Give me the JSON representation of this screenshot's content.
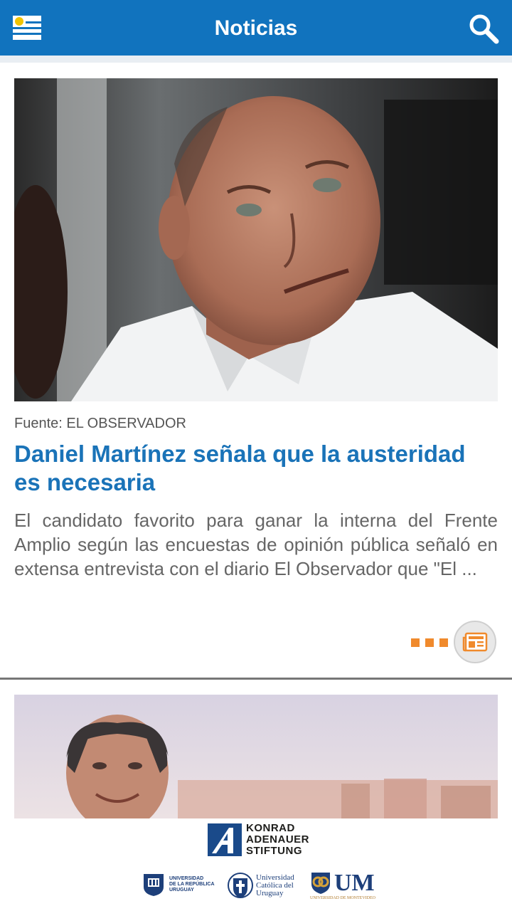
{
  "appbar": {
    "title": "Noticias",
    "menu_icon": "uruguay-flag-menu-icon",
    "search_icon": "search-icon",
    "color": "#1173be"
  },
  "articles": [
    {
      "source": "Fuente: EL OBSERVADOR",
      "headline": "Daniel Martínez señala que la austeridad es necesaria",
      "summary": "El candidato favorito para ganar la interna del Frente Amplio según las encuestas de opinión pública señaló en extensa entrevista con el diario El Observador que \"El ...",
      "read_icon": "newspaper-icon"
    },
    {
      "source": "",
      "headline": "",
      "summary": ""
    }
  ],
  "accent_color": "#f08a2c",
  "headline_color": "#1a73b8",
  "sponsors": {
    "kas_name": "KONRAD ADENAUER STIFTUNG",
    "kas_lines": [
      "KONRAD",
      "ADENAUER",
      "STIFTUNG"
    ],
    "udelar_lines": [
      "UNIVERSIDAD",
      "DE LA REPÚBLICA",
      "URUGUAY"
    ],
    "ucu_lines": [
      "Universidad",
      "Católica del",
      "Uruguay"
    ],
    "um_short": "UM",
    "um_full": "UNIVERSIDAD DE MONTEVIDEO"
  }
}
